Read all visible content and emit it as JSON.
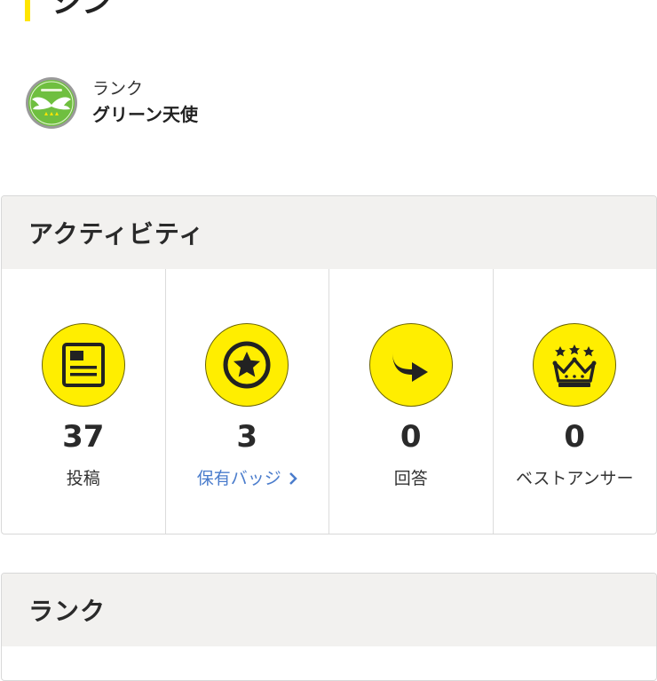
{
  "page": {
    "title": "シン"
  },
  "rank": {
    "label": "ランク",
    "name": "グリーン天使"
  },
  "activity": {
    "title": "アクティビティ",
    "stats": [
      {
        "value": "37",
        "label": "投稿",
        "icon": "document-icon"
      },
      {
        "value": "3",
        "label": "保有バッジ",
        "icon": "star-badge-icon",
        "link": true
      },
      {
        "value": "0",
        "label": "回答",
        "icon": "reply-arrow-icon"
      },
      {
        "value": "0",
        "label": "ベストアンサー",
        "icon": "crown-icon"
      }
    ]
  },
  "rank_section": {
    "title": "ランク"
  },
  "colors": {
    "accent": "#ffe500",
    "icon_bg": "#ffee00",
    "link": "#4a7ccc",
    "header_bg": "#f2f1ef"
  }
}
